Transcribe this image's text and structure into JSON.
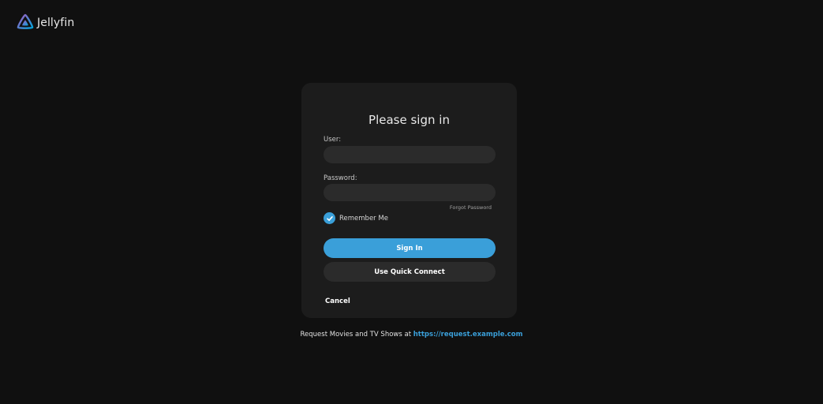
{
  "header": {
    "app_name": "Jellyfin"
  },
  "login": {
    "title": "Please sign in",
    "user_label": "User:",
    "user_value": "",
    "password_label": "Password:",
    "password_value": "",
    "forgot_password": "Forgot Password",
    "remember_me": "Remember Me",
    "remember_me_checked": true,
    "sign_in": "Sign In",
    "quick_connect": "Use Quick Connect",
    "cancel": "Cancel"
  },
  "footer": {
    "text": "Request Movies and TV Shows at ",
    "link": "https://request.example.com"
  },
  "colors": {
    "accent": "#3a9fd9",
    "background": "#101010",
    "card": "#1c1c1c",
    "input": "#2b2b2b"
  },
  "icons": {
    "logo": "jellyfin-logo-icon",
    "check": "check-icon"
  }
}
